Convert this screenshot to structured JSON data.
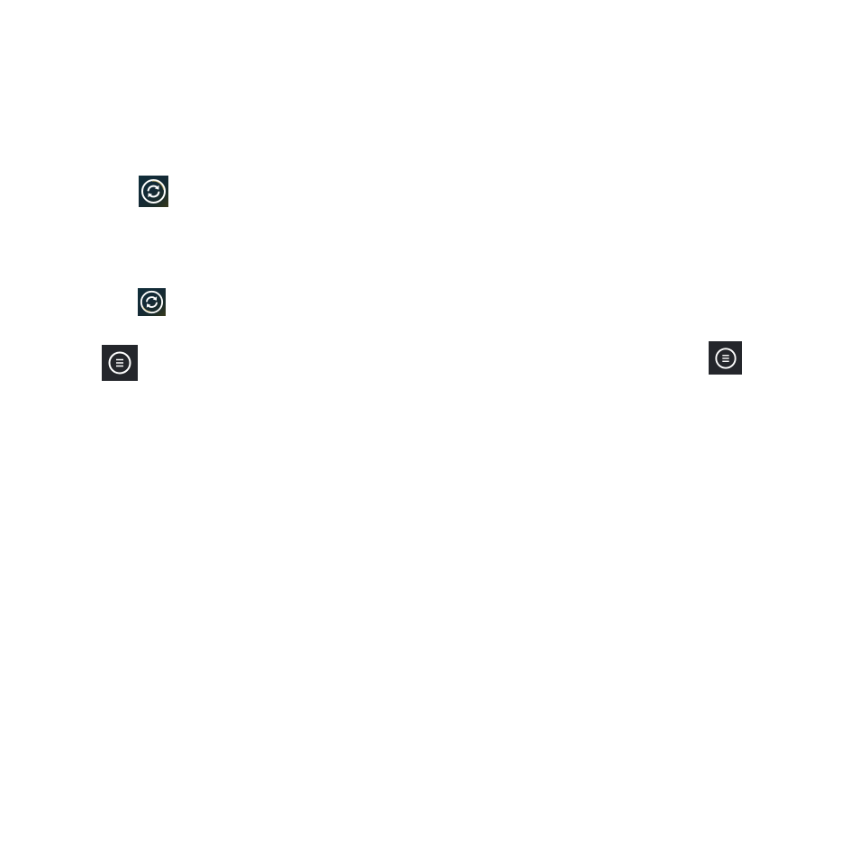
{
  "screen": {
    "background": "#ffffff"
  },
  "buttons": [
    {
      "id": "sync-1",
      "icon": "sync-icon",
      "tile_color": "#142a36",
      "glyph_color": "#ffffff",
      "ring_accent": "#c9b46a"
    },
    {
      "id": "sync-2",
      "icon": "sync-icon",
      "tile_color": "#142a36",
      "glyph_color": "#ffffff",
      "ring_accent": "#c9b46a"
    },
    {
      "id": "menu-1",
      "icon": "menu-circle-icon",
      "tile_color": "#24262b",
      "glyph_color": "#ffffff"
    },
    {
      "id": "menu-2",
      "icon": "menu-circle-icon",
      "tile_color": "#24262b",
      "glyph_color": "#ffffff"
    }
  ]
}
